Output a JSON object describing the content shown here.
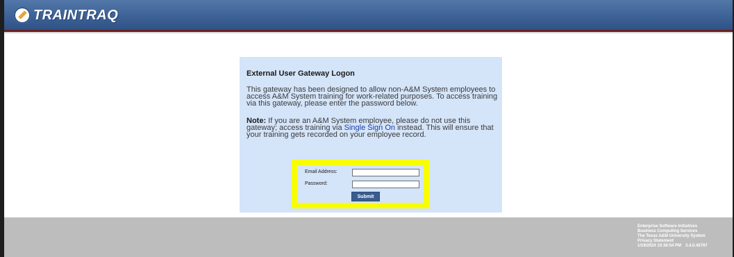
{
  "header": {
    "brand": "TRAINTRAQ"
  },
  "panel": {
    "title": "External User Gateway Logon",
    "intro": "This gateway has been designed to allow non-A&M System employees to access A&M System training for work-related purposes. To access training via this gateway, please enter the password below.",
    "note_label": "Note:",
    "note_before": " If you are an A&M System employee, please do not use this gateway; access training via ",
    "note_link": "Single Sign On",
    "note_after": " instead. This will ensure that your training gets recorded on your employee record."
  },
  "login": {
    "email_label": "Email Address:",
    "email_value": "",
    "password_label": "Password:",
    "password_value": "",
    "submit_label": "Submit"
  },
  "footer": {
    "line1": "Enterprise Software Initiatives",
    "line2": "Business Computing Services",
    "line3": "The Texas A&M University System",
    "privacy": "Privacy Statement",
    "timestamp": "1/19/2024 10:38:54 PM",
    "version": "3.4.0.40767"
  },
  "colors": {
    "header": "#3d6296",
    "panel": "#d4e4f9",
    "highlight": "#f8fe00",
    "footer": "#bdbdbd",
    "link": "#1a3ea8"
  }
}
